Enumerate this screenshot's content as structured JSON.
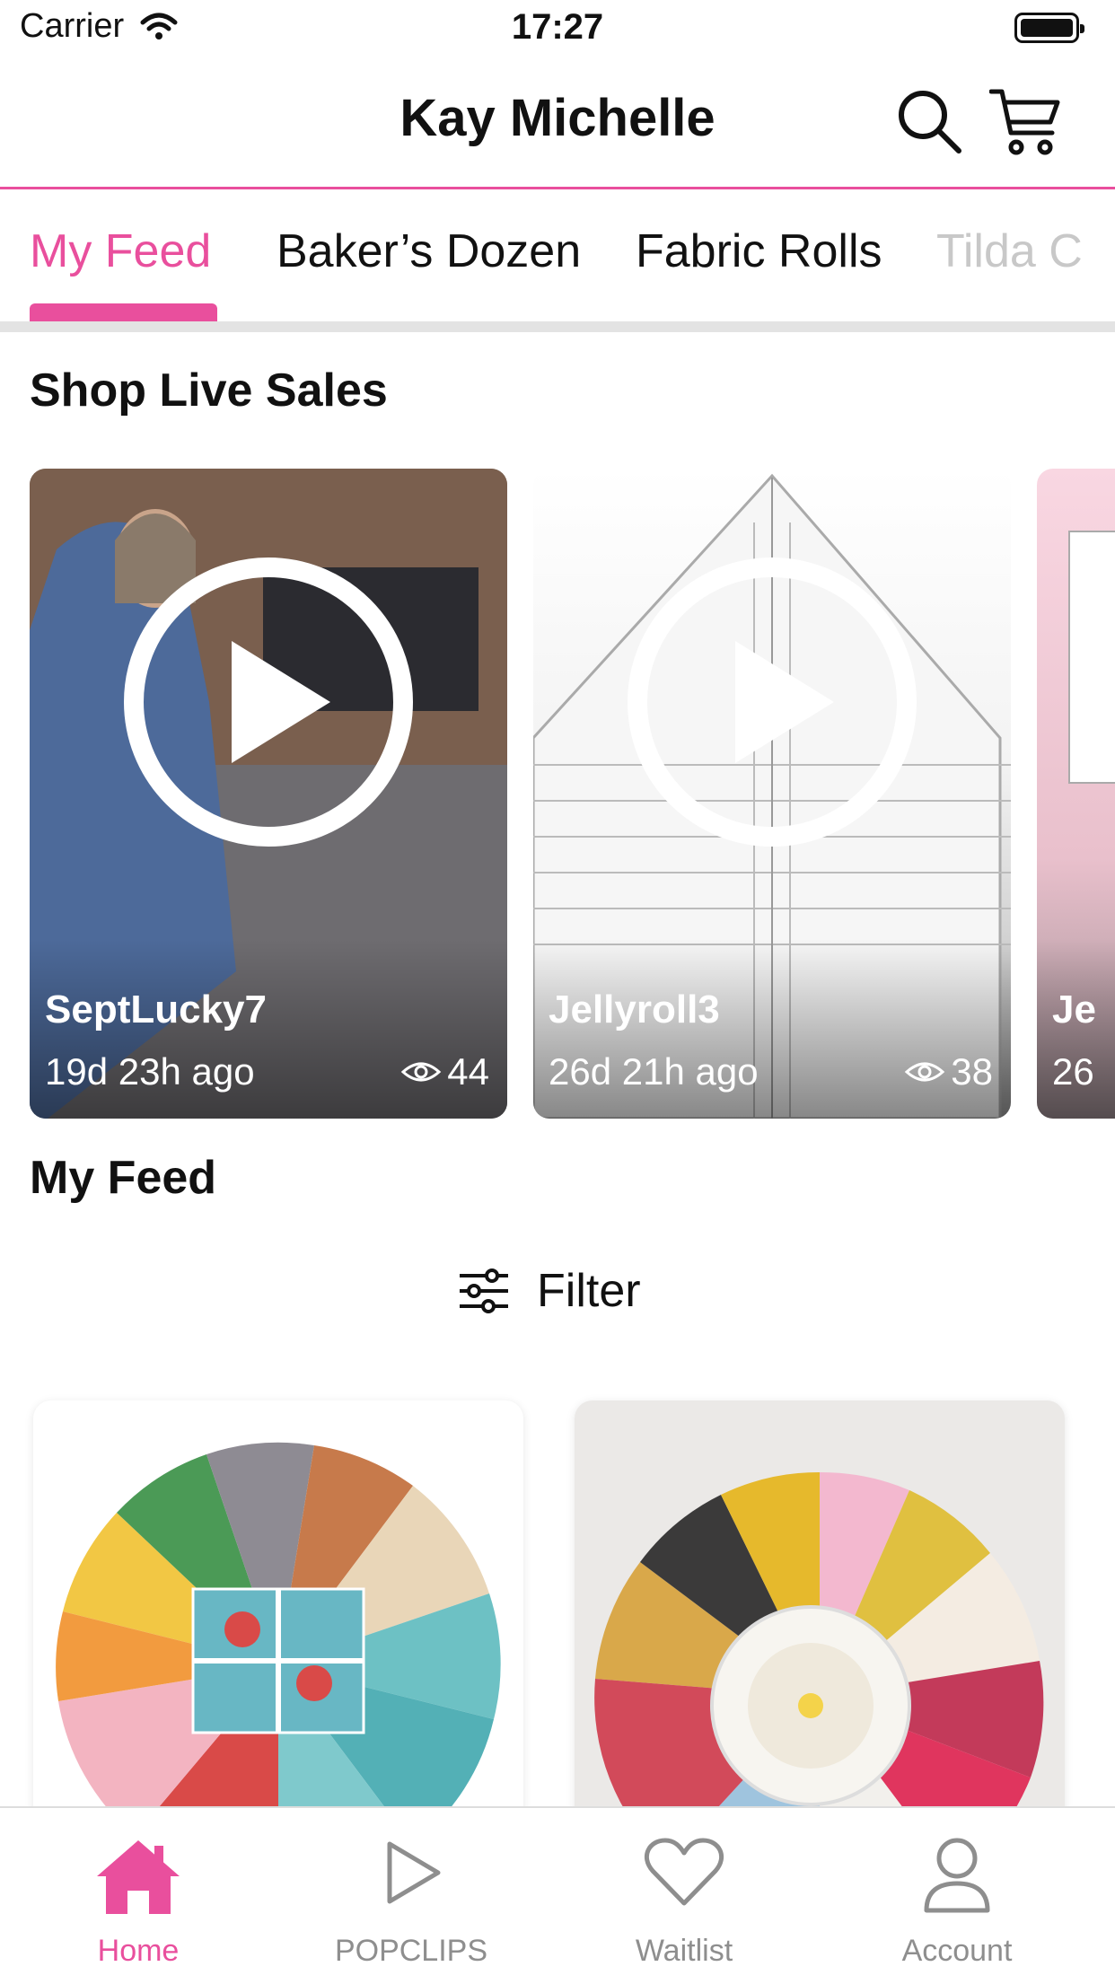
{
  "status_bar": {
    "carrier": "Carrier",
    "time": "17:27"
  },
  "header": {
    "title": "Kay Michelle"
  },
  "tabs": [
    "My Feed",
    "Baker’s Dozen",
    "Fabric Rolls",
    "Tilda C"
  ],
  "live_sales": {
    "title": "Shop Live Sales",
    "items": [
      {
        "name": "SeptLucky7",
        "ago": "19d 23h ago",
        "views": "44"
      },
      {
        "name": "Jellyroll3",
        "ago": "26d 21h ago",
        "views": "38"
      },
      {
        "name": "Je",
        "ago": "26"
      }
    ]
  },
  "feed": {
    "title": "My Feed",
    "filter_label": "Filter"
  },
  "bottom_nav": [
    "Home",
    "POPCLIPS",
    "Waitlist",
    "Account"
  ],
  "colors": {
    "accent": "#e94f9d"
  }
}
